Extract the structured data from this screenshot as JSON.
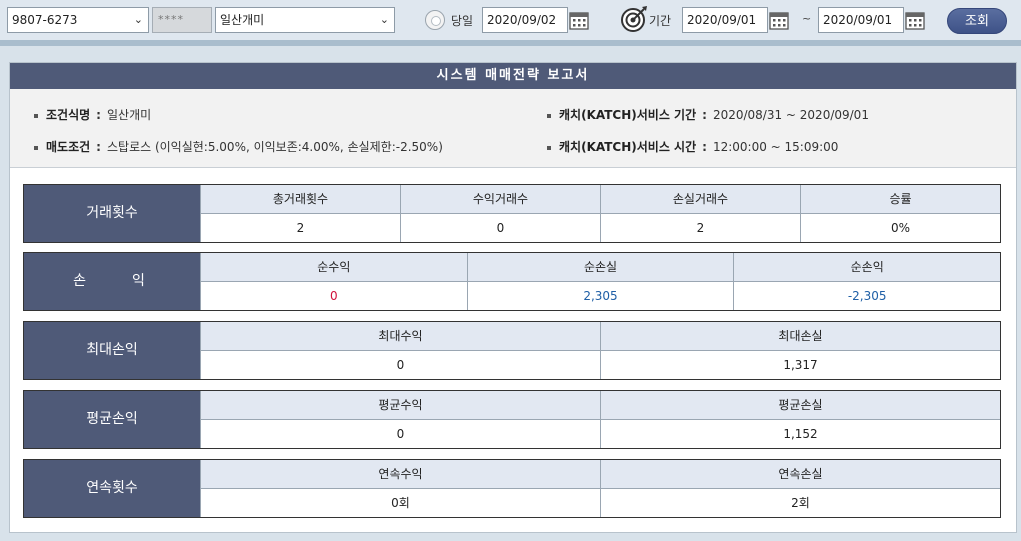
{
  "toolbar": {
    "account": "9807-6273",
    "password_mask": "****",
    "strategy": "일산개미",
    "today_label": "당일",
    "today_date": "2020/09/02",
    "period_label": "기간",
    "period_from": "2020/09/01",
    "period_sep": "~",
    "period_to": "2020/09/01",
    "search_label": "조회"
  },
  "report": {
    "title": "시스템 매매전략 보고서",
    "conditions": {
      "strategy_name_label": "조건식명",
      "strategy_name_value": "일산개미",
      "sell_cond_label": "매도조건",
      "sell_cond_value": "스탑로스 (이익실현:5.00%, 이익보존:4.00%, 손실제한:-2.50%)",
      "catch_period_label": "캐치(KATCH)서비스 기간",
      "catch_period_value": "2020/08/31 ~ 2020/09/01",
      "catch_time_label": "캐치(KATCH)서비스 시간",
      "catch_time_value": "12:00:00 ~ 15:09:00"
    },
    "trade_count": {
      "head": "거래횟수",
      "cols": [
        {
          "label": "총거래횟수",
          "value": "2"
        },
        {
          "label": "수익거래수",
          "value": "0"
        },
        {
          "label": "손실거래수",
          "value": "2"
        },
        {
          "label": "승률",
          "value": "0%"
        }
      ]
    },
    "profit_loss": {
      "head": "손　　익",
      "cols": [
        {
          "label": "순수익",
          "value": "0"
        },
        {
          "label": "순손실",
          "value": "2,305"
        },
        {
          "label": "순손익",
          "value": "-2,305"
        }
      ]
    },
    "max_pl": {
      "head": "최대손익",
      "cols": [
        {
          "label": "최대수익",
          "value": "0"
        },
        {
          "label": "최대손실",
          "value": "1,317"
        }
      ]
    },
    "avg_pl": {
      "head": "평균손익",
      "cols": [
        {
          "label": "평균수익",
          "value": "0"
        },
        {
          "label": "평균손실",
          "value": "1,152"
        }
      ]
    },
    "streak": {
      "head": "연속횟수",
      "cols": [
        {
          "label": "연속수익",
          "value": "0회"
        },
        {
          "label": "연속손실",
          "value": "2회"
        }
      ]
    }
  },
  "colors": {
    "header_bg": "#4f5a78",
    "profit_red": "#d0113a",
    "loss_blue": "#1f5fa6"
  }
}
